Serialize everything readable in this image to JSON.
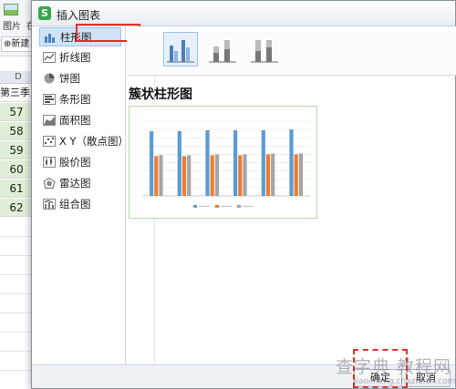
{
  "background_sheet": {
    "ribbon_labels": [
      "图片",
      "在"
    ],
    "new_button": "新建",
    "column_letter": "D",
    "header_cell": "第三季度",
    "values": [
      "57",
      "58",
      "59",
      "60",
      "61",
      "62"
    ]
  },
  "dialog": {
    "title": "插入图表",
    "app_logo": "S",
    "chart_types": [
      {
        "label": "柱形图",
        "icon": "bar-chart-icon"
      },
      {
        "label": "折线图",
        "icon": "line-chart-icon"
      },
      {
        "label": "饼图",
        "icon": "pie-chart-icon"
      },
      {
        "label": "条形图",
        "icon": "horizontal-bar-icon"
      },
      {
        "label": "面积图",
        "icon": "area-chart-icon"
      },
      {
        "label": "X Y（散点图）",
        "icon": "scatter-chart-icon"
      },
      {
        "label": "股价图",
        "icon": "stock-chart-icon"
      },
      {
        "label": "雷达图",
        "icon": "radar-chart-icon"
      },
      {
        "label": "组合图",
        "icon": "combo-chart-icon"
      }
    ],
    "selected_type": "柱形图",
    "subtype_count": 3,
    "preview_title": "簇状柱形图",
    "ok_label": "确定",
    "cancel_label": "取消"
  },
  "chart_data": {
    "type": "bar",
    "categories": [
      "",
      "",
      "",
      "",
      "",
      ""
    ],
    "series": [
      {
        "values": [
          78,
          78,
          79,
          79,
          79,
          80
        ]
      },
      {
        "values": [
          48,
          48,
          49,
          49,
          50,
          50
        ]
      },
      {
        "values": [
          49,
          49,
          50,
          50,
          51,
          51
        ]
      }
    ],
    "ylim": [
      0,
      90
    ],
    "colors": [
      "#5b9bd5",
      "#ed7d31",
      "#a5a5a5"
    ],
    "grid": true,
    "legend": "bottom"
  },
  "watermark": {
    "main": "查字典 教程网",
    "sub": "jiaocheng.chazidian.com"
  }
}
